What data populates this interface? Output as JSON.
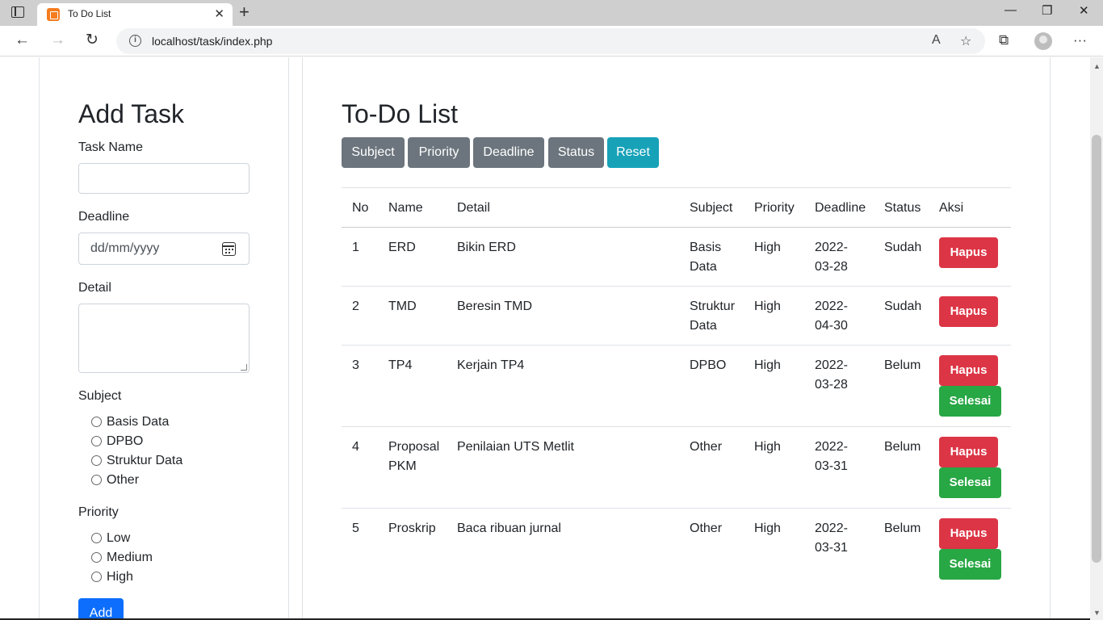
{
  "browser": {
    "tab_title": "To Do List",
    "tab_close": "✕",
    "new_tab": "+",
    "minimize": "—",
    "restore": "❐",
    "close": "✕",
    "back": "←",
    "forward": "→",
    "reload": "↻",
    "url": "localhost/task/index.php",
    "read_aloud": "A",
    "favorite": "☆",
    "collections": "⧉",
    "menu": "···"
  },
  "add_task": {
    "title": "Add Task",
    "task_name_label": "Task Name",
    "deadline_label": "Deadline",
    "deadline_placeholder": "dd/mm/yyyy",
    "detail_label": "Detail",
    "subject_label": "Subject",
    "subjects": [
      "Basis Data",
      "DPBO",
      "Struktur Data",
      "Other"
    ],
    "priority_label": "Priority",
    "priorities": [
      "Low",
      "Medium",
      "High"
    ],
    "add_button": "Add"
  },
  "todo": {
    "title": "To-Do List",
    "filters": [
      "Subject",
      "Priority",
      "Deadline",
      "Status",
      "Reset"
    ],
    "columns": [
      "No",
      "Name",
      "Detail",
      "Subject",
      "Priority",
      "Deadline",
      "Status",
      "Aksi"
    ],
    "rows": [
      {
        "no": "1",
        "name": [
          "ERD"
        ],
        "detail": "Bikin ERD",
        "subject": [
          "Basis",
          "Data"
        ],
        "priority": "High",
        "deadline": [
          "2022-",
          "03-28"
        ],
        "status": "Sudah"
      },
      {
        "no": "2",
        "name": [
          "TMD"
        ],
        "detail": "Beresin TMD",
        "subject": [
          "Struktur",
          "Data"
        ],
        "priority": "High",
        "deadline": [
          "2022-",
          "04-30"
        ],
        "status": "Sudah"
      },
      {
        "no": "3",
        "name": [
          "TP4"
        ],
        "detail": "Kerjain TP4",
        "subject": [
          "DPBO"
        ],
        "priority": "High",
        "deadline": [
          "2022-",
          "03-28"
        ],
        "status": "Belum"
      },
      {
        "no": "4",
        "name": [
          "Proposal",
          "PKM"
        ],
        "detail": "Penilaian UTS Metlit",
        "subject": [
          "Other"
        ],
        "priority": "High",
        "deadline": [
          "2022-",
          "03-31"
        ],
        "status": "Belum"
      },
      {
        "no": "5",
        "name": [
          "Proskrip"
        ],
        "detail": "Baca ribuan jurnal",
        "subject": [
          "Other"
        ],
        "priority": "High",
        "deadline": [
          "2022-",
          "03-31"
        ],
        "status": "Belum"
      }
    ],
    "hapus_label": "Hapus",
    "selesai_label": "Selesai"
  }
}
